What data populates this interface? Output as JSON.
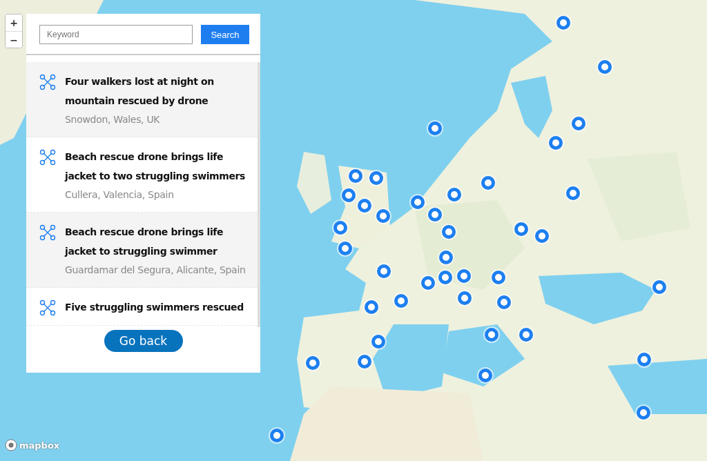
{
  "map": {
    "kind": "picture",
    "zoom_controls": [
      "+",
      "−"
    ],
    "attribution": "mapbox"
  },
  "panel": {
    "search": {
      "placeholder": "Keyword",
      "button": "Search"
    },
    "stories": [
      {
        "title": "Four walkers lost at night on mountain rescued by drone",
        "location": "Snowdon, Wales, UK"
      },
      {
        "title": "Beach rescue drone brings life jacket to two struggling swimmers",
        "location": "Cullera, Valencia, Spain"
      },
      {
        "title": "Beach rescue drone brings life jacket to struggling swimmer",
        "location": "Guardamar del Segura, Alicante, Spain"
      },
      {
        "title": "Five struggling swimmers rescued"
      }
    ],
    "back_button": "Go back"
  }
}
